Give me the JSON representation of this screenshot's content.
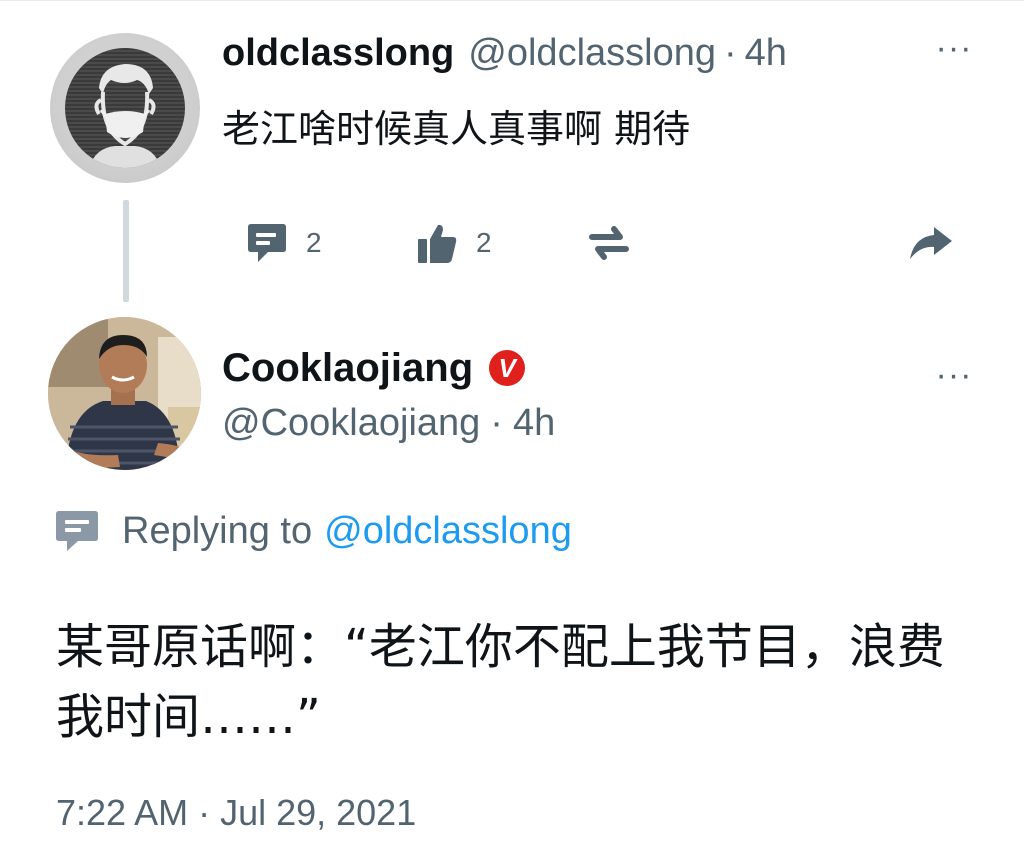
{
  "parent_tweet": {
    "display_name": "oldclasslong",
    "handle": "@oldclasslong",
    "separator": "·",
    "time": "4h",
    "text": "老江啥时候真人真事啊 期待",
    "more_label": "···",
    "reply_count": "2",
    "like_count": "2",
    "icons": [
      "comment-icon",
      "thumbs-up-icon",
      "retweet-icon",
      "share-icon"
    ]
  },
  "reply_tweet": {
    "display_name": "Cooklaojiang",
    "verified_badge": "V",
    "handle": "@Cooklaojiang",
    "separator": "·",
    "time": "4h",
    "more_label": "···",
    "replying_prefix": "Replying to",
    "replying_handle": "@oldclasslong",
    "text": "某哥原话啊：“老江你不配上我节目，浪费我时间……”",
    "timestamp": "7:22 AM · Jul 29, 2021"
  },
  "colors": {
    "text": "#0f1419",
    "secondary": "#536471",
    "link": "#1d9bf0",
    "verified": "#e0201c",
    "thread_line": "#cfd9de"
  }
}
